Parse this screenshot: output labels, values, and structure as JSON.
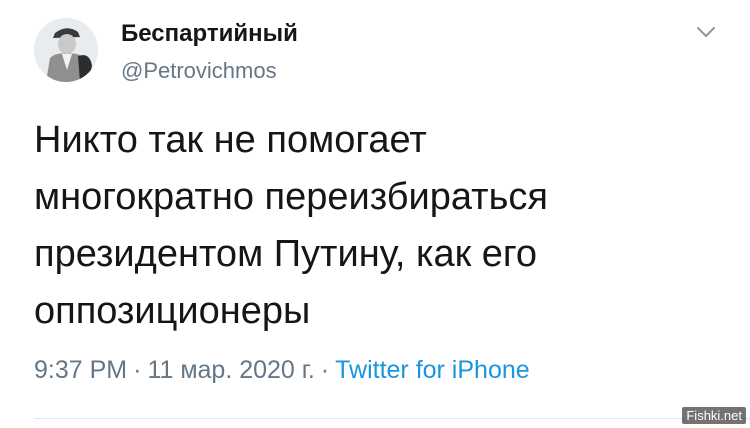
{
  "author": {
    "display_name": "Беспартийный",
    "handle": "@Petrovichmos",
    "avatar_icon": "user-avatar-icon"
  },
  "menu": {
    "icon": "chevron-down-icon"
  },
  "tweet": {
    "lines": [
      "Никто так не помогает",
      "многократно переизбираться",
      "президентом Путину, как его",
      "оппозиционеры"
    ]
  },
  "meta": {
    "time": "9:37 PM",
    "separator": "·",
    "date": "11 мар. 2020 г.",
    "source": "Twitter for iPhone"
  },
  "watermark": {
    "text": "Fishki.net"
  },
  "colors": {
    "text": "#14171a",
    "secondary": "#657786",
    "link": "#1b95e0"
  }
}
